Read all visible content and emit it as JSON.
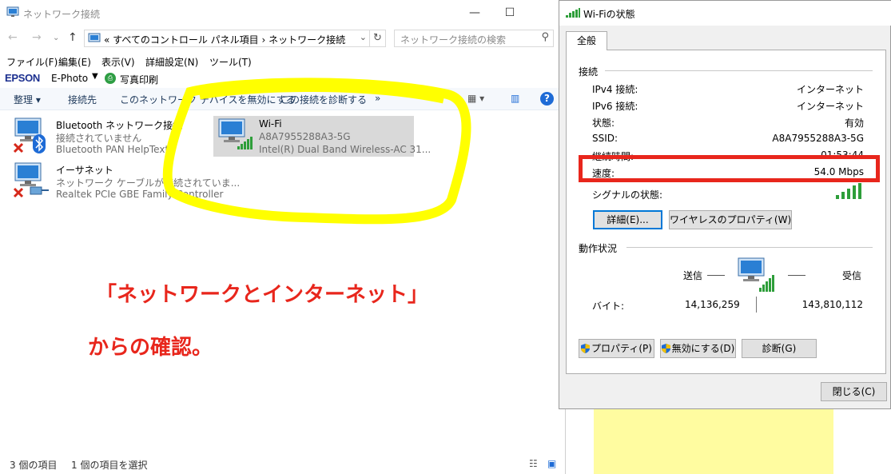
{
  "explorer": {
    "title": "ネットワーク接続",
    "window_buttons": {
      "minimize": "—",
      "maximize": "☐"
    },
    "address": {
      "path": "«  すべてのコントロール パネル項目  ›  ネットワーク接続"
    },
    "search": {
      "placeholder": "ネットワーク接続の検索"
    },
    "menu": [
      "ファイル(F)",
      "編集(E)",
      "表示(V)",
      "詳細設定(N)",
      "ツール(T)"
    ],
    "epson": {
      "logo": "EPSON",
      "app": "E-Photo",
      "print": "写真印刷"
    },
    "commands": {
      "organize": "整理 ▾",
      "connect_to": "接続先",
      "disable": "このネットワーク デバイスを無効にする",
      "diagnose": "この接続を診断する",
      "more": "»"
    },
    "items": [
      {
        "name": "Bluetooth ネットワーク接続",
        "status": "接続されていません",
        "device": "Bluetooth PAN HelpText"
      },
      {
        "name": "イーサネット",
        "status": "ネットワーク ケーブルが接続されていま...",
        "device": "Realtek PCIe GBE Family Controller"
      },
      {
        "name": "Wi-Fi",
        "status": "A8A7955288A3-5G",
        "device": "Intel(R) Dual Band Wireless-AC 31..."
      }
    ],
    "statusbar": {
      "count": "3 個の項目",
      "selected": "1 個の項目を選択"
    }
  },
  "annotation": {
    "line1": "「ネットワークとインターネット」",
    "line2": "からの確認。",
    "color": "#e8261c",
    "highlight_color": "#ffff00"
  },
  "dialog": {
    "title": "Wi-Fiの状態",
    "tab": "全般",
    "connection_header": "接続",
    "rows": [
      {
        "label": "IPv4 接続:",
        "value": "インターネット"
      },
      {
        "label": "IPv6 接続:",
        "value": "インターネット"
      },
      {
        "label": "状態:",
        "value": "有効"
      },
      {
        "label": "SSID:",
        "value": "A8A7955288A3-5G"
      },
      {
        "label": "継続時間:",
        "value": "01:53:44"
      },
      {
        "label": "速度:",
        "value": "54.0 Mbps"
      }
    ],
    "signal_label": "シグナルの状態:",
    "signal_bars": 5,
    "buttons": {
      "details": "詳細(E)...",
      "wireless_props": "ワイヤレスのプロパティ(W)"
    },
    "activity_header": "動作状況",
    "sent_label": "送信",
    "received_label": "受信",
    "bytes_label": "バイト:",
    "bytes_sent": "14,136,259",
    "bytes_received": "143,810,112",
    "bottom_buttons": {
      "properties": "プロパティ(P)",
      "disable": "無効にする(D)",
      "diagnose": "診断(G)"
    },
    "close": "閉じる(C)"
  }
}
